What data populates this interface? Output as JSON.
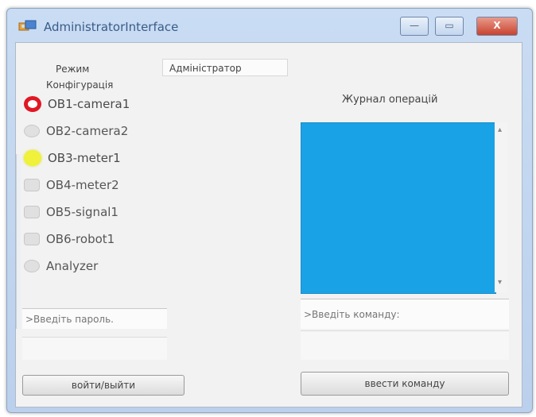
{
  "window": {
    "title": "AdministratorInterface",
    "controls": {
      "minimize": "—",
      "maximize": "▭",
      "close": "X"
    }
  },
  "left_panel": {
    "mode_label": "Режим",
    "mode_value": "Адміністратор",
    "config_label": "Конфігурація",
    "devices": [
      {
        "name": "OB1-camera1",
        "status": "red"
      },
      {
        "name": "OB2-camera2",
        "status": "gray"
      },
      {
        "name": "OB3-meter1",
        "status": "yellow"
      },
      {
        "name": "OB4-meter2",
        "status": "gray"
      },
      {
        "name": "OB5-signal1",
        "status": "gray"
      },
      {
        "name": "OB6-robot1",
        "status": "gray"
      },
      {
        "name": "Analyzer",
        "status": "gray"
      }
    ],
    "password_placeholder": ">Введіть пароль.",
    "login_button": "войти/выйти"
  },
  "right_panel": {
    "log_label": "Журнал операцій",
    "log_color": "#1aa2e6",
    "command_placeholder": ">Введіть команду:",
    "submit_button": "ввести команду"
  }
}
